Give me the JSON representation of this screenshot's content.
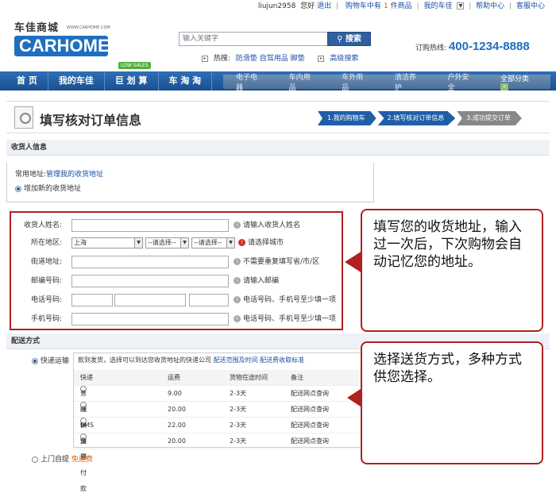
{
  "topbar": {
    "user": "liujun2958",
    "greeting": "您好",
    "logout": "退出",
    "cart_pre": "购物车中有",
    "cart_count": "1",
    "cart_post": "件商品",
    "my_carhome": "我的车佳",
    "help": "帮助中心",
    "service": "客服中心"
  },
  "logo": {
    "cn": "车佳商城",
    "en": "CARHOME",
    "url": "WWW.CARHOME.COM"
  },
  "search": {
    "placeholder": "输入关键字",
    "button": "搜索",
    "hot_label": "热搜:",
    "hot_items": [
      "防滑垫",
      "自驾用品",
      "脚垫"
    ],
    "advanced": "高级搜索"
  },
  "hotline": {
    "label": "订购热线:",
    "number": "400-1234-8888"
  },
  "nav": {
    "main": [
      "首 页",
      "我的车佳",
      "巨 划 算",
      "车 淘 淘"
    ],
    "badge": "LOW SALES",
    "sub": [
      "电子电器",
      "车内用品",
      "车外用品",
      "清洁养护",
      "户外安全"
    ],
    "all": "全部分类"
  },
  "page": {
    "title": "填写核对订单信息",
    "steps": [
      "1.我的购物车",
      "2.填写核对订单信息",
      "3.成功提交订单"
    ]
  },
  "receiver": {
    "section_title": "收货人信息",
    "common_label": "常用地址:",
    "manage_link": "管理我的收货地址",
    "add_new": "增加新的收货地址",
    "fields": {
      "name_label": "收货人姓名:",
      "name_hint": "请输入收货人姓名",
      "region_label": "所在地区:",
      "province": "上海",
      "city": "--请选择--",
      "district": "--请选择--",
      "region_hint": "请选择城市",
      "street_label": "街道地址:",
      "street_hint": "不需要重复填写省/市/区",
      "zip_label": "邮编号码:",
      "zip_hint": "请输入邮编",
      "phone_label": "电话号码:",
      "phone_hint": "电话号码、手机号至少填一项",
      "mobile_label": "手机号码:",
      "mobile_hint": "电话号码、手机号至少填一项"
    }
  },
  "callouts": {
    "address": "填写您的收货地址，输入过一次后，下次购物会自动记忆您的地址。",
    "shipping": "选择送货方式，多种方式供您选择。"
  },
  "shipping": {
    "section_title": "配送方式",
    "express_label": "快递运输",
    "note": "款到发货，选择可以到达您收货地址的快递公司",
    "note_link1": "配送范围及时间",
    "note_link2": "配送费收取标准",
    "columns": [
      "快递",
      "运费",
      "货物在途时间",
      "备注"
    ],
    "rows": [
      {
        "name": "普通快递",
        "fee": "9.00",
        "time": "2-3天",
        "remark": "配送网点查询"
      },
      {
        "name": "顺丰快递",
        "fee": "20.00",
        "time": "2-3天",
        "remark": "配送网点查询"
      },
      {
        "name": "EMS",
        "fee": "22.00",
        "time": "2-3天",
        "remark": "配送网点查询"
      },
      {
        "name": "货到付款",
        "fee": "20.00",
        "time": "2-3天",
        "remark": "配送网点查询"
      }
    ],
    "pickup_label": "上门自提",
    "pickup_free": "免运费"
  }
}
